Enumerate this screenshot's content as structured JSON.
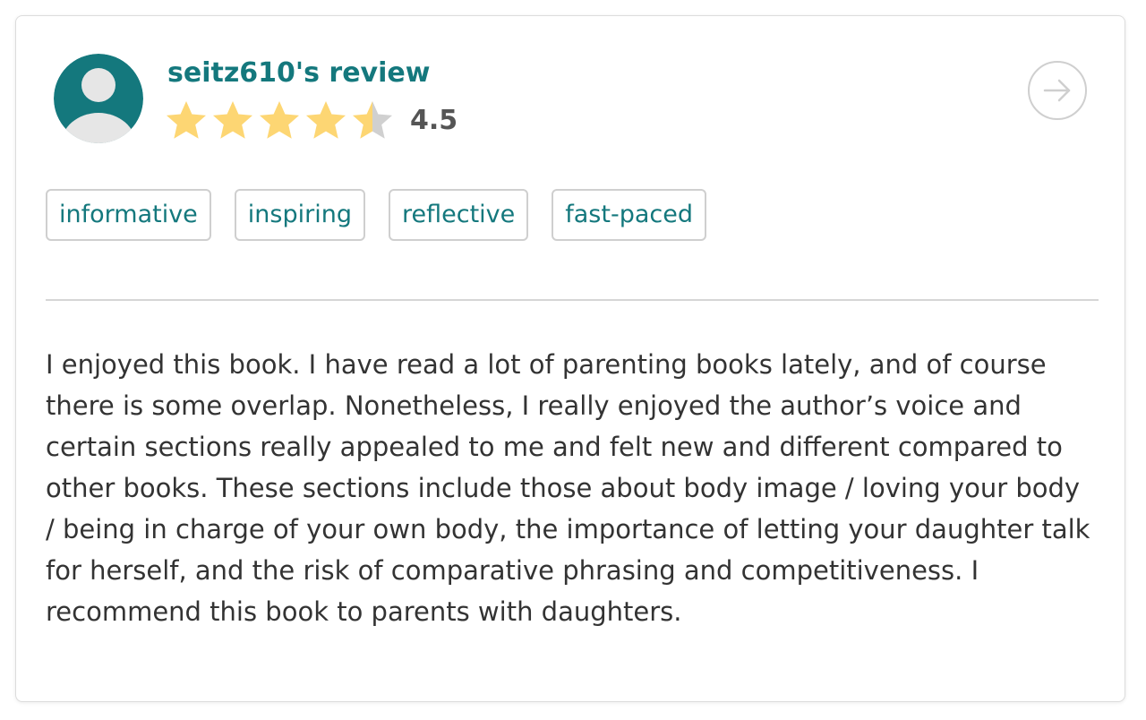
{
  "review": {
    "title": "seitz610's review",
    "rating_value": "4.5",
    "rating": 4.5,
    "rating_max": 5,
    "tags": [
      "informative",
      "inspiring",
      "reflective",
      "fast-paced"
    ],
    "body": "I enjoyed this book. I have read a lot of parenting books lately, and of course there is some overlap. Nonetheless, I really enjoyed the author’s voice and certain sections really appealed to me and felt new and different compared to other books. These sections include those about body image / loving your body / being in charge of your own body, the importance of letting your daughter talk for herself, and the risk of comparative phrasing and competitiveness. I recommend this book to parents with daughters."
  },
  "icons": {
    "avatar": "user-avatar-icon",
    "star": "star-icon",
    "next": "arrow-right-icon"
  },
  "colors": {
    "accent": "#14787d",
    "star_filled": "#fdd673",
    "star_empty": "#d0d0d0",
    "avatar_bg": "#14787d",
    "avatar_figure": "#e6e6e6",
    "text": "#333333",
    "border": "#cfcfcf"
  }
}
